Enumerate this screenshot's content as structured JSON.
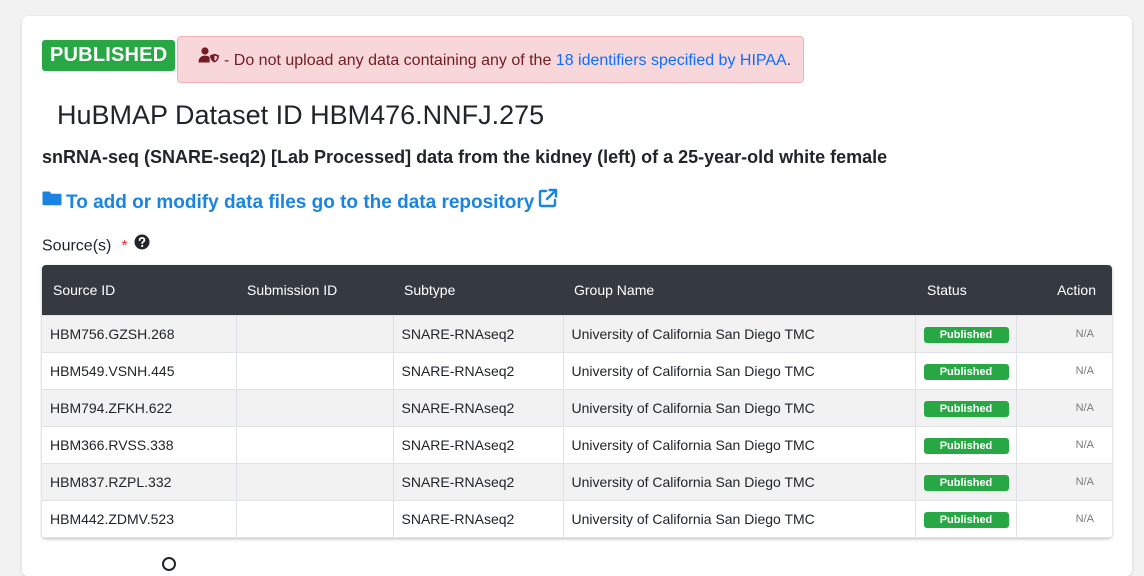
{
  "status_badge": "PUBLISHED",
  "hipaa": {
    "prefix": "- Do not upload any data containing any of the ",
    "link": "18 identifiers specified by HIPAA",
    "suffix": "."
  },
  "dataset": {
    "title": "HuBMAP Dataset ID HBM476.NNFJ.275",
    "subtitle": "snRNA-seq (SNARE-seq2) [Lab Processed] data from the kidney (left) of a 25-year-old white female"
  },
  "repo_link": "To add or modify data files go to the data repository",
  "sources": {
    "label": "Source(s)",
    "required_marker": "*",
    "columns": [
      "Source ID",
      "Submission ID",
      "Subtype",
      "Group Name",
      "Status",
      "Action"
    ],
    "rows": [
      {
        "source_id": "HBM756.GZSH.268",
        "submission_id": "",
        "subtype": "SNARE-RNAseq2",
        "group": "University of California San Diego TMC",
        "status": "Published",
        "action": "N/A"
      },
      {
        "source_id": "HBM549.VSNH.445",
        "submission_id": "",
        "subtype": "SNARE-RNAseq2",
        "group": "University of California San Diego TMC",
        "status": "Published",
        "action": "N/A"
      },
      {
        "source_id": "HBM794.ZFKH.622",
        "submission_id": "",
        "subtype": "SNARE-RNAseq2",
        "group": "University of California San Diego TMC",
        "status": "Published",
        "action": "N/A"
      },
      {
        "source_id": "HBM366.RVSS.338",
        "submission_id": "",
        "subtype": "SNARE-RNAseq2",
        "group": "University of California San Diego TMC",
        "status": "Published",
        "action": "N/A"
      },
      {
        "source_id": "HBM837.RZPL.332",
        "submission_id": "",
        "subtype": "SNARE-RNAseq2",
        "group": "University of California San Diego TMC",
        "status": "Published",
        "action": "N/A"
      },
      {
        "source_id": "HBM442.ZDMV.523",
        "submission_id": "",
        "subtype": "SNARE-RNAseq2",
        "group": "University of California San Diego TMC",
        "status": "Published",
        "action": "N/A"
      }
    ]
  },
  "icons": {
    "alert": "user-shield-icon",
    "repo": "folder-icon",
    "external": "external-link-icon",
    "help": "question-circle-icon"
  },
  "colors": {
    "published": "#28a745",
    "alert_bg": "#f8d7da",
    "alert_text": "#721c24",
    "link": "#1a84e0",
    "table_header": "#343a40",
    "required": "#dc3545"
  }
}
